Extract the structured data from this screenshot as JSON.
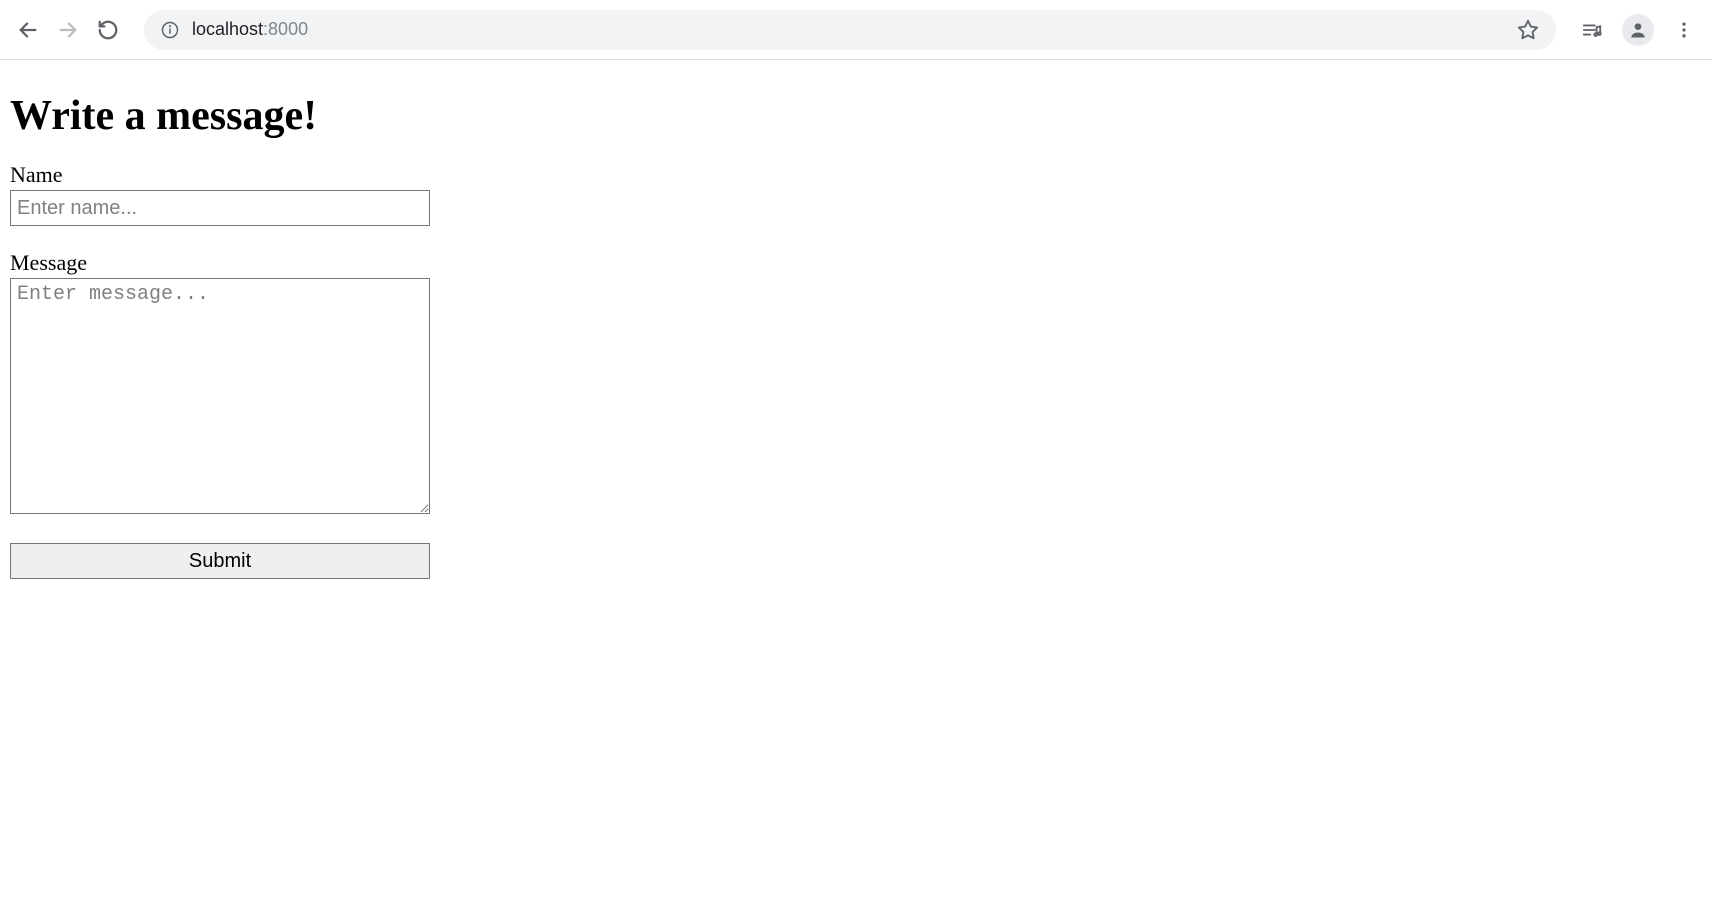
{
  "browser": {
    "url_host": "localhost",
    "url_port": ":8000"
  },
  "page": {
    "heading": "Write a message!"
  },
  "form": {
    "name": {
      "label": "Name",
      "placeholder": "Enter name...",
      "value": ""
    },
    "message": {
      "label": "Message",
      "placeholder": "Enter message...",
      "value": ""
    },
    "submit_label": "Submit"
  }
}
